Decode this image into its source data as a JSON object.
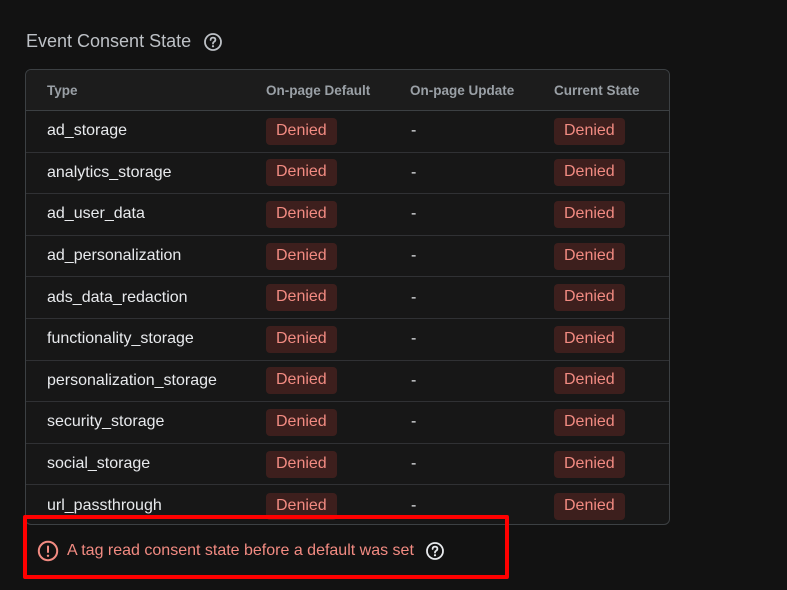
{
  "section": {
    "title": "Event Consent State",
    "help_icon": "help-circle-icon"
  },
  "table": {
    "columns": [
      "Type",
      "On-page Default",
      "On-page Update",
      "Current State"
    ],
    "rows": [
      {
        "type": "ad_storage",
        "default": "Denied",
        "update": "-",
        "current": "Denied"
      },
      {
        "type": "analytics_storage",
        "default": "Denied",
        "update": "-",
        "current": "Denied"
      },
      {
        "type": "ad_user_data",
        "default": "Denied",
        "update": "-",
        "current": "Denied"
      },
      {
        "type": "ad_personalization",
        "default": "Denied",
        "update": "-",
        "current": "Denied"
      },
      {
        "type": "ads_data_redaction",
        "default": "Denied",
        "update": "-",
        "current": "Denied"
      },
      {
        "type": "functionality_storage",
        "default": "Denied",
        "update": "-",
        "current": "Denied"
      },
      {
        "type": "personalization_storage",
        "default": "Denied",
        "update": "-",
        "current": "Denied"
      },
      {
        "type": "security_storage",
        "default": "Denied",
        "update": "-",
        "current": "Denied"
      },
      {
        "type": "social_storage",
        "default": "Denied",
        "update": "-",
        "current": "Denied"
      },
      {
        "type": "url_passthrough",
        "default": "Denied",
        "update": "-",
        "current": "Denied"
      }
    ]
  },
  "warning": {
    "text": "A tag read consent state before a default was set",
    "icon": "error-circle-icon",
    "help_icon": "help-circle-icon"
  },
  "colors": {
    "background": "#121212",
    "denied_text": "#f28b82",
    "denied_bg": "#3d1f1d",
    "highlight_border": "#ff0000"
  }
}
